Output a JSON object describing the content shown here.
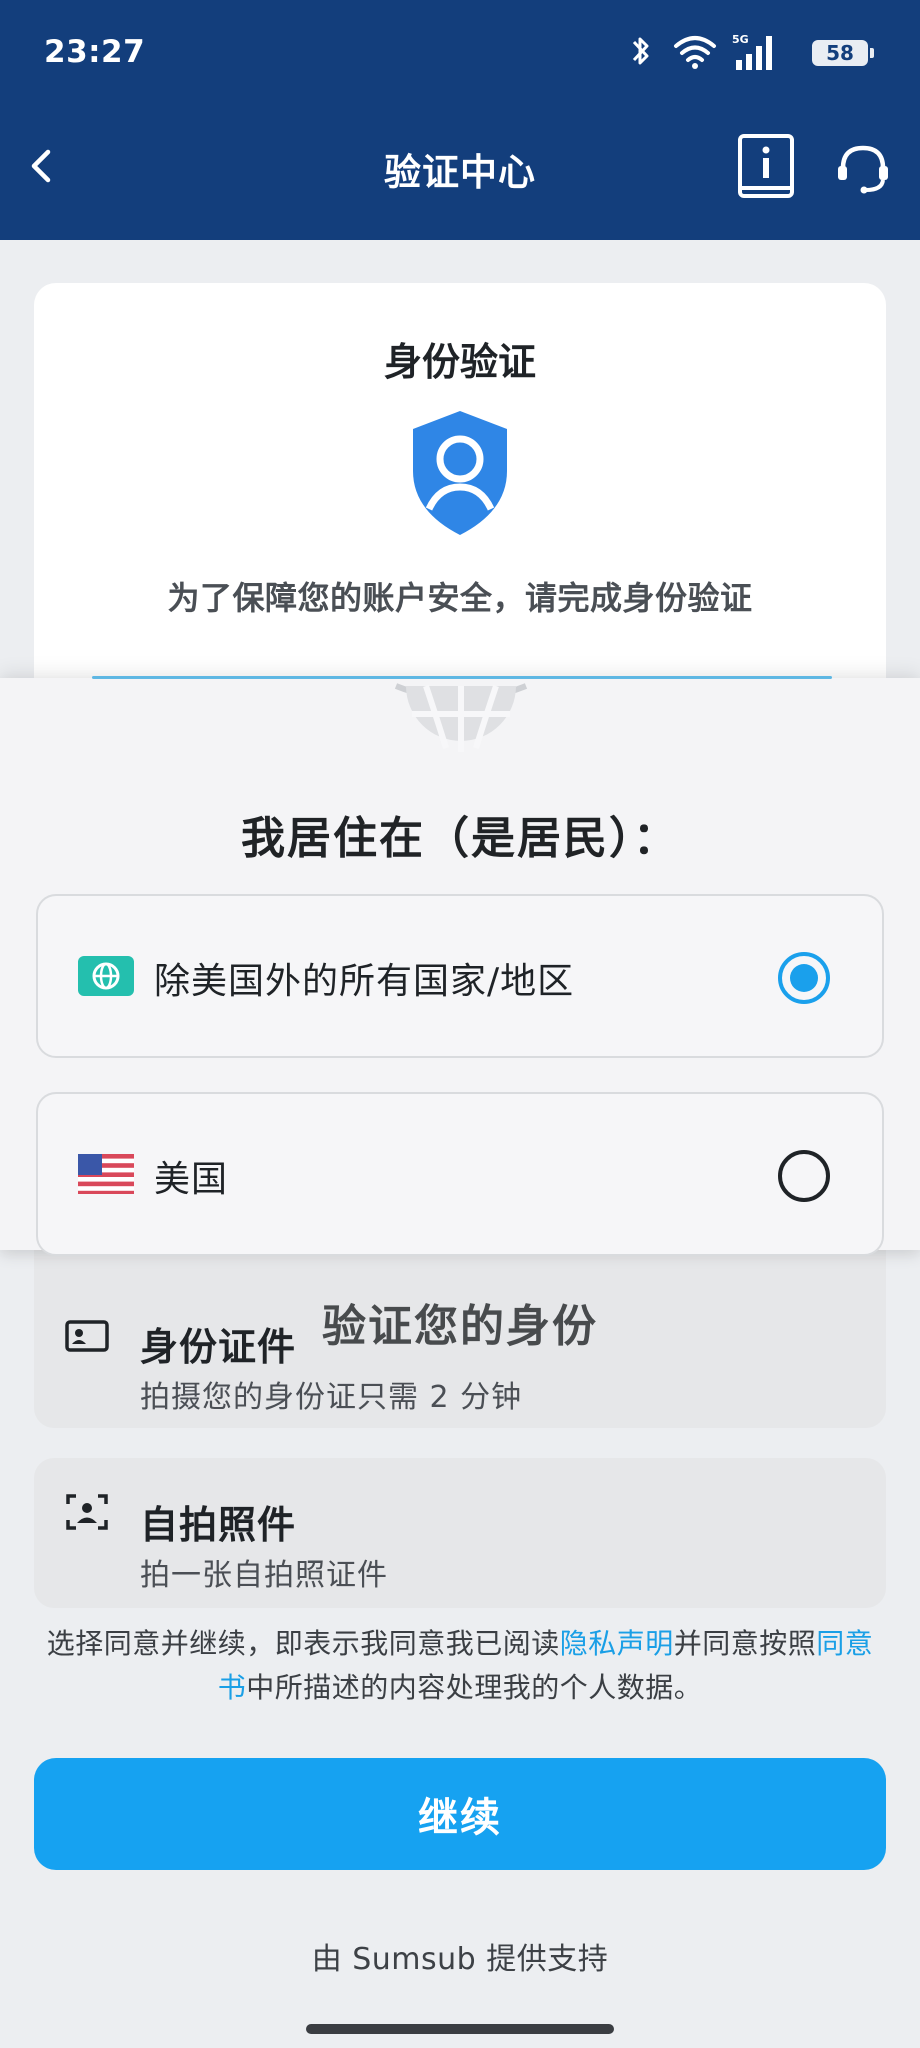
{
  "status_bar": {
    "time": "23:27",
    "battery": "58",
    "network": "5G"
  },
  "header": {
    "title": "验证中心",
    "bg_color": "#133e7c"
  },
  "verify_card": {
    "title": "身份验证",
    "description": "为了保障您的账户安全，请完成身份验证"
  },
  "residence_sheet": {
    "title": "我居住在（是居民）：",
    "options": [
      {
        "label": "除美国外的所有国家/地区",
        "icon": "globe-icon",
        "selected": true
      },
      {
        "label": "美国",
        "icon": "us-flag-icon",
        "selected": false
      }
    ]
  },
  "methods": {
    "heading": "验证您的身份",
    "items": [
      {
        "title": "身份证件",
        "subtitle": "拍摄您的身份证只需 2 分钟",
        "icon": "id-card-icon"
      },
      {
        "title": "自拍照件",
        "subtitle": "拍一张自拍照证件",
        "icon": "selfie-scan-icon"
      }
    ]
  },
  "consent": {
    "part1": "选择同意并继续，即表示我同意我已阅读",
    "privacy_link": "隐私声明",
    "part2": "并同意按照",
    "agreement_link": "同意书",
    "part3": "中所描述的内容处理我的个人数据。"
  },
  "continue_label": "继续",
  "footer": {
    "powered_by": "由 Sumsub 提供支持"
  },
  "colors": {
    "accent": "#16a2f1",
    "link": "#1a9fe6",
    "shield": "#2f86e6"
  }
}
